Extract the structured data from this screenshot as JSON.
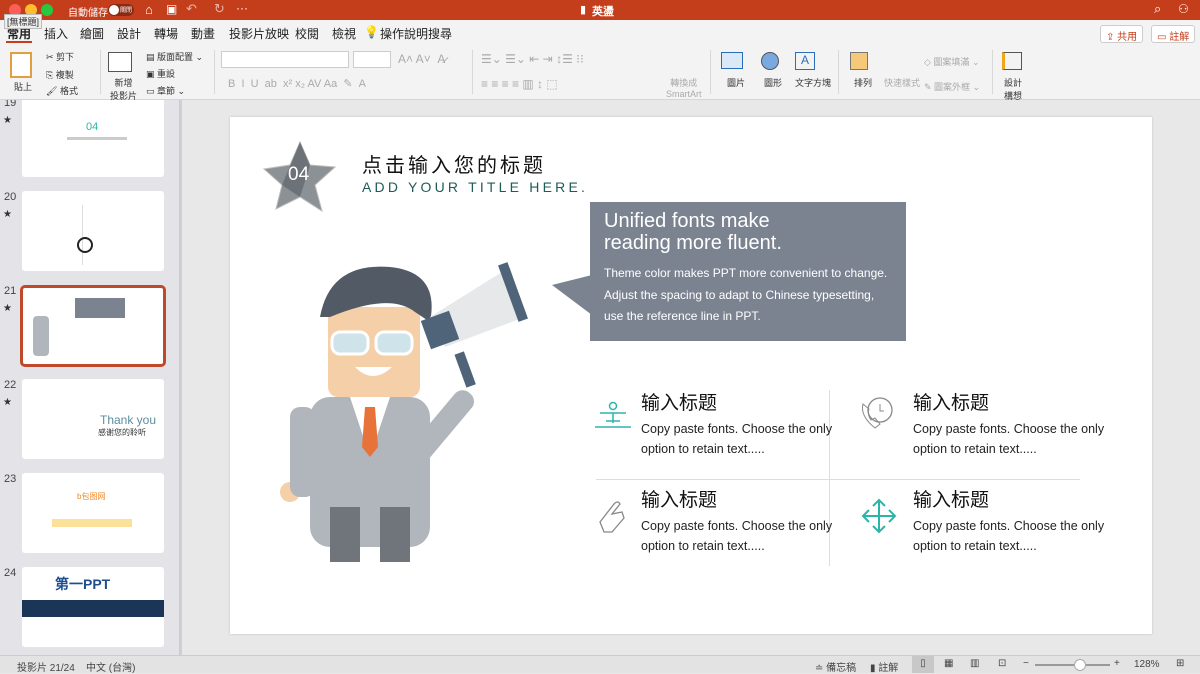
{
  "titlebar": {
    "autosave": "自動儲存",
    "toggle": "關閉",
    "doc_title": "英盪",
    "tooltip": "[無標題]"
  },
  "tabs": [
    "常用",
    "插入",
    "繪圖",
    "設計",
    "轉場",
    "動畫",
    "投影片放映",
    "校閱",
    "檢視"
  ],
  "search": "操作說明搜尋",
  "share": "共用",
  "comments": "註解",
  "ribbon": {
    "paste": "貼上",
    "cut": "剪下",
    "copy": "複製",
    "format": "格式",
    "new_slide": "新增\n投影片",
    "layout": "版面配置",
    "reset": "重設",
    "section": "章節",
    "smartart": "轉換成\nSmartArt",
    "picture": "圖片",
    "shape": "圖形",
    "textbox": "文字方塊",
    "arrange": "排列",
    "quick_styles": "快速樣式",
    "fill": "圖案填滿",
    "outline": "圖案外框",
    "designer": "設計\n構想"
  },
  "thumbnails": [
    {
      "num": "19",
      "text": "04"
    },
    {
      "num": "20"
    },
    {
      "num": "21"
    },
    {
      "num": "22",
      "text": "Thank you",
      "sub": "感谢您的聆听"
    },
    {
      "num": "23",
      "text": "b包图网"
    },
    {
      "num": "24",
      "text": "第一PPT"
    }
  ],
  "slide": {
    "badge": "04",
    "title_cn": "点击输入您的标题",
    "title_en": "ADD YOUR TITLE HERE.",
    "callout_title": "Unified fonts make reading more fluent.",
    "callout_body": "Theme color makes PPT more convenient to change. Adjust the spacing to adapt to Chinese typesetting, use the reference line in PPT.",
    "items": [
      {
        "title": "输入标题",
        "text": "Copy paste fonts. Choose the only option to retain text.....",
        "icon": "podium-icon"
      },
      {
        "title": "输入标题",
        "text": "Copy paste fonts. Choose the only option to retain text.....",
        "icon": "phone-clock-icon"
      },
      {
        "title": "输入标题",
        "text": "Copy paste fonts. Choose the only option to retain text.....",
        "icon": "hand-pointer-icon"
      },
      {
        "title": "输入标题",
        "text": "Copy paste fonts. Choose the only option to retain text.....",
        "icon": "move-arrows-icon"
      }
    ]
  },
  "status": {
    "slide": "投影片 21/24",
    "lang": "中文 (台灣)",
    "notes": "備忘稿",
    "comments": "註解",
    "zoom": "128%",
    "zoom_level": 0.6
  },
  "colors": {
    "accent": "#c43e1c",
    "teal": "#2bb5a8",
    "callout": "#7b8391"
  }
}
